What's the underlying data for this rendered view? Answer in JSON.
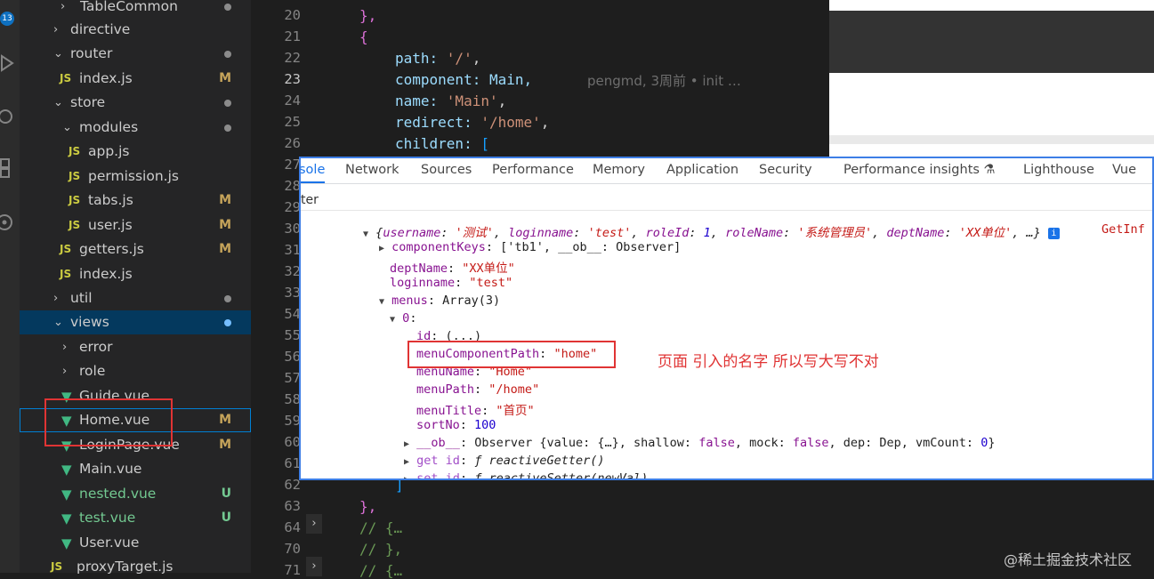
{
  "activity_bar": {
    "badge_count": "13"
  },
  "explorer": {
    "items": [
      {
        "label": "TableCommon",
        "status": "dot"
      },
      {
        "label": "directive",
        "status": ""
      },
      {
        "label": "router",
        "status": "dot"
      },
      {
        "label": "index.js",
        "status": "M"
      },
      {
        "label": "store",
        "status": "dot"
      },
      {
        "label": "modules",
        "status": "dot"
      },
      {
        "label": "app.js",
        "status": ""
      },
      {
        "label": "permission.js",
        "status": ""
      },
      {
        "label": "tabs.js",
        "status": "M"
      },
      {
        "label": "user.js",
        "status": "M"
      },
      {
        "label": "getters.js",
        "status": "M"
      },
      {
        "label": "index.js",
        "status": ""
      },
      {
        "label": "util",
        "status": "dot"
      },
      {
        "label": "views",
        "status": "dot"
      },
      {
        "label": "error",
        "status": ""
      },
      {
        "label": "role",
        "status": ""
      },
      {
        "label": "Guide.vue",
        "status": ""
      },
      {
        "label": "Home.vue",
        "status": "M"
      },
      {
        "label": "LoginPage.vue",
        "status": "M"
      },
      {
        "label": "Main.vue",
        "status": ""
      },
      {
        "label": "nested.vue",
        "status": "U"
      },
      {
        "label": "test.vue",
        "status": "U"
      },
      {
        "label": "User.vue",
        "status": ""
      },
      {
        "label": "proxyTarget.js",
        "status": ""
      }
    ]
  },
  "editor": {
    "line_numbers": [
      "20",
      "21",
      "22",
      "23",
      "24",
      "25",
      "26",
      "27",
      "28",
      "29",
      "30",
      "31",
      "32",
      "33",
      "54",
      "55",
      "56",
      "57",
      "58",
      "59",
      "60",
      "61",
      "62",
      "63",
      "64",
      "70",
      "71"
    ],
    "lines": {
      "l20": "},",
      "l21": "{",
      "l22_key": "path: ",
      "l22_val": "'/'",
      "l23_key": "component: ",
      "l23_val": "Main,",
      "l23_blame": "pengmd, 3周前 • init …",
      "l24_key": "name: ",
      "l24_val": "'Main'",
      "l25_key": "redirect: ",
      "l25_val": "'/home'",
      "l26_key": "children: ",
      "l26_val": "[",
      "l27": "// {",
      "l62": "]",
      "l63": "},",
      "l64": "// {…",
      "l70": "// },",
      "l71": "// {…"
    }
  },
  "devtools": {
    "tabs": [
      "sole",
      "Network",
      "Sources",
      "Performance",
      "Memory",
      "Application",
      "Security",
      "Performance insights",
      "Lighthouse",
      "Vue"
    ],
    "filter_placeholder": "ter",
    "console": {
      "summary_open": "{",
      "summary_username_key": "username",
      "summary_username_val": "'测试'",
      "summary_loginname_key": "loginname",
      "summary_loginname_val": "'test'",
      "summary_roleid_key": "roleId",
      "summary_roleid_val": "1",
      "summary_rolename_key": "roleName",
      "summary_rolename_val": "'系统管理员'",
      "summary_deptname_key": "deptName",
      "summary_deptname_val": "'XX单位'",
      "summary_close": "…}",
      "source_link": "GetInf",
      "componentKeys_key": "componentKeys",
      "componentKeys_val": "['tb1', __ob__: Observer]",
      "deptName_key": "deptName",
      "deptName_val": "\"XX单位\"",
      "loginname_key": "loginname",
      "loginname_val": "\"test\"",
      "menus_key": "menus",
      "menus_val": "Array(3)",
      "index0": "0",
      "id_key": "id",
      "id_val": "(...)",
      "menuComponentPath_key": "menuComponentPath",
      "menuComponentPath_val": "\"home\"",
      "menuName_key": "menuName",
      "menuName_val": "\"Home\"",
      "menuPath_key": "menuPath",
      "menuPath_val": "\"/home\"",
      "menuTitle_key": "menuTitle",
      "menuTitle_val": "\"首页\"",
      "sortNo_key": "sortNo",
      "sortNo_val": "100",
      "ob_key": "__ob__",
      "ob_val_a": "Observer {value: {…}, shallow: ",
      "ob_false1": "false",
      "ob_val_b": ", mock: ",
      "ob_false2": "false",
      "ob_val_c": ", dep: Dep, vmCount: ",
      "ob_zero": "0",
      "ob_val_d": "}",
      "getid_key": "get id",
      "getid_val": "ƒ reactiveGetter()",
      "setid_key": "set id",
      "setid_val": "ƒ reactiveSetter(newVal)"
    }
  },
  "annotation": "页面 引入的名字 所以写大写不对",
  "watermark": "@稀土掘金技术社区",
  "colors": {
    "annotation": "#e03434",
    "accent": "#1a73e8"
  }
}
